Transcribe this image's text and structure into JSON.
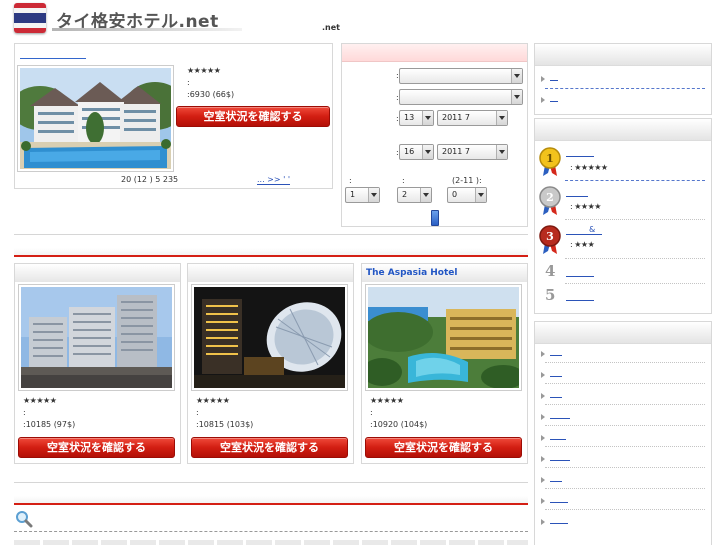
{
  "site": {
    "title": "タイ格安ホテル.net",
    "tagline": ".net"
  },
  "featured": {
    "stars": "★★★★★",
    "line2": ":",
    "price": ":6930 (66$)",
    "button": "空室状況を確認する",
    "footer_text": "20  (12  )      5     235",
    "more_prefix": "... ",
    "more_link": ">> '            '"
  },
  "search": {
    "row_colon": ":",
    "check_in_day": "13",
    "check_in_month": "2011 7",
    "check_out_day": "16",
    "check_out_month": "2011 7",
    "rooms_label": ":",
    "adults_label": ":",
    "children_label": "(2-11 ):",
    "rooms_value": "1",
    "adults_value": "2",
    "children_value": "0"
  },
  "cards": [
    {
      "title": "",
      "stars": "★★★★★",
      "line2": ":",
      "price": ":10185 (97$)",
      "button": "空室状況を確認する"
    },
    {
      "title": "",
      "stars": "★★★★★",
      "line2": ":",
      "price": ":10815 (103$)",
      "button": "空室状況を確認する"
    },
    {
      "title": "The Aspasia Hotel",
      "stars": "★★★★★",
      "line2": ":",
      "price": ":10920 (104$)",
      "button": "空室状況を確認する"
    }
  ],
  "ranking": [
    {
      "rank": "1",
      "stars": ": ★★★★★"
    },
    {
      "rank": "2",
      "stars": ": ★★★★"
    },
    {
      "rank": "3",
      "link_amp": "&",
      "stars": ": ★★★"
    },
    {
      "rank": "4"
    },
    {
      "rank": "5"
    }
  ],
  "colors": {
    "accent_red": "#d41f14",
    "link_blue": "#2b53b8",
    "star_gold": "#e4b400"
  },
  "icons": [
    "thai-flag-logo",
    "gold-medal-icon",
    "silver-medal-icon",
    "bronze-medal-icon",
    "search-magnifier-icon"
  ]
}
